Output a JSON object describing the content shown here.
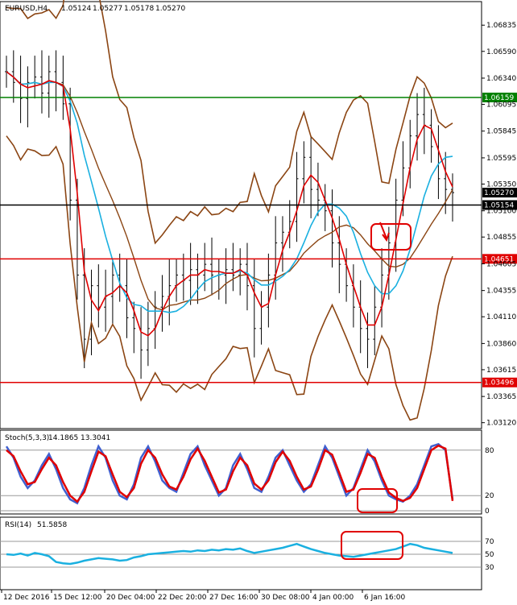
{
  "chart_data": {
    "type": "candlestick",
    "symbol_header": "EURUSD,H4",
    "ohlc": {
      "open": "1.05124",
      "high": "1.05277",
      "low": "1.05178",
      "close": "1.05270"
    },
    "y_ticks": [
      "1.06835",
      "1.06590",
      "1.06340",
      "1.06095",
      "1.05845",
      "1.05595",
      "1.05350",
      "1.05100",
      "1.04855",
      "1.04605",
      "1.04355",
      "1.04110",
      "1.03860",
      "1.03615",
      "1.03365",
      "1.03120"
    ],
    "ylim": [
      1.0308,
      1.0704
    ],
    "x_ticks": [
      "12 Dec 2016",
      "15 Dec 12:00",
      "20 Dec 04:00",
      "22 Dec 20:00",
      "27 Dec 16:00",
      "30 Dec 08:00",
      "4 Jan 00:00",
      "6 Jan 16:00"
    ],
    "horizontal_lines": [
      {
        "value": 1.06159,
        "label": "1.06159",
        "color": "#008000"
      },
      {
        "value": 1.05154,
        "label": "1.05154",
        "color": "#000000"
      },
      {
        "value": 1.04651,
        "label": "1.04651",
        "color": "#e00000"
      },
      {
        "value": 1.03496,
        "label": "1.03496",
        "color": "#e00000"
      }
    ],
    "current_price": {
      "value": 1.0527,
      "label": "1.05270"
    },
    "close_series": [
      1.064,
      1.063,
      1.0615,
      1.063,
      1.0635,
      1.062,
      1.064,
      1.063,
      1.061,
      1.052,
      1.045,
      1.039,
      1.044,
      1.042,
      1.043,
      1.045,
      1.044,
      1.041,
      1.04,
      1.038,
      1.04,
      1.042,
      1.043,
      1.044,
      1.045,
      1.0445,
      1.0455,
      1.045,
      1.046,
      1.045,
      1.045,
      1.0455,
      1.045,
      1.046,
      1.044,
      1.04,
      1.042,
      1.045,
      1.048,
      1.049,
      1.05,
      1.054,
      1.056,
      1.053,
      1.052,
      1.051,
      1.048,
      1.046,
      1.044,
      1.042,
      1.04,
      1.039,
      1.042,
      1.045,
      1.048,
      1.052,
      1.055,
      1.058,
      1.06,
      1.059,
      1.057,
      1.054,
      1.053,
      1.0527
    ],
    "indicators": [
      {
        "name": "Stoch(5,3,3)",
        "values": [
          "14.1865",
          "13.3041"
        ],
        "levels": [
          "80",
          "20",
          "0"
        ],
        "ylim": [
          0,
          100
        ],
        "main": [
          85,
          70,
          45,
          30,
          40,
          60,
          75,
          55,
          30,
          15,
          10,
          30,
          60,
          85,
          70,
          40,
          20,
          15,
          35,
          70,
          85,
          65,
          40,
          30,
          25,
          50,
          75,
          85,
          60,
          40,
          20,
          30,
          60,
          75,
          55,
          30,
          25,
          45,
          70,
          80,
          60,
          40,
          25,
          35,
          60,
          85,
          70,
          45,
          20,
          30,
          55,
          80,
          65,
          40,
          20,
          15,
          12,
          20,
          35,
          60,
          85,
          88,
          80,
          15
        ],
        "signal": [
          80,
          72,
          52,
          35,
          38,
          55,
          70,
          60,
          38,
          20,
          12,
          25,
          52,
          78,
          72,
          48,
          25,
          18,
          30,
          62,
          80,
          70,
          48,
          32,
          28,
          45,
          68,
          82,
          66,
          45,
          24,
          28,
          52,
          70,
          60,
          36,
          28,
          40,
          64,
          78,
          66,
          45,
          28,
          32,
          54,
          80,
          74,
          50,
          25,
          28,
          50,
          75,
          70,
          45,
          24,
          17,
          13,
          17,
          30,
          55,
          80,
          86,
          82,
          13
        ]
      },
      {
        "name": "RSI(14)",
        "values": [
          "51.5858"
        ],
        "levels": [
          "70",
          "50",
          "30"
        ],
        "ylim": [
          0,
          100
        ],
        "values_series": [
          50,
          49,
          51,
          48,
          52,
          50,
          47,
          38,
          36,
          35,
          37,
          40,
          42,
          44,
          43,
          42,
          40,
          41,
          45,
          47,
          50,
          51,
          52,
          53,
          54,
          55,
          54,
          56,
          55,
          57,
          56,
          58,
          57,
          59,
          55,
          52,
          54,
          56,
          58,
          60,
          63,
          66,
          62,
          58,
          55,
          52,
          50,
          48,
          47,
          46,
          48,
          50,
          52,
          54,
          56,
          58,
          62,
          66,
          64,
          60,
          58,
          56,
          54,
          52
        ]
      }
    ]
  }
}
